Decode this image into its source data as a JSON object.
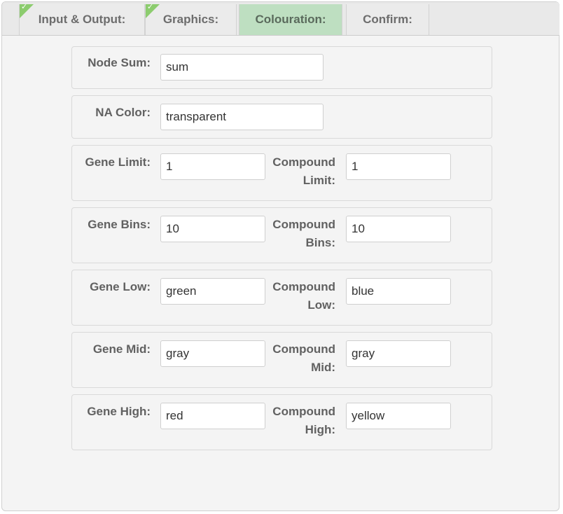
{
  "tabs": [
    {
      "label": "Input & Output:",
      "completed": true
    },
    {
      "label": "Graphics:",
      "completed": true
    },
    {
      "label": "Colouration:",
      "active": true
    },
    {
      "label": "Confirm:"
    }
  ],
  "form": {
    "node_sum": {
      "label": "Node Sum:",
      "value": "sum"
    },
    "na_color": {
      "label": "NA Color:",
      "value": "transparent"
    },
    "limit": {
      "gene_label": "Gene Limit:",
      "gene_value": "1",
      "compound_label_line1": "Compound",
      "compound_label_line2": "Limit:",
      "compound_value": "1"
    },
    "bins": {
      "gene_label": "Gene Bins:",
      "gene_value": "10",
      "compound_label_line1": "Compound",
      "compound_label_line2": "Bins:",
      "compound_value": "10"
    },
    "low": {
      "gene_label": "Gene Low:",
      "gene_value": "green",
      "compound_label_line1": "Compound",
      "compound_label_line2": "Low:",
      "compound_value": "blue"
    },
    "mid": {
      "gene_label": "Gene Mid:",
      "gene_value": "gray",
      "compound_label_line1": "Compound",
      "compound_label_line2": "Mid:",
      "compound_value": "gray"
    },
    "high": {
      "gene_label": "Gene High:",
      "gene_value": "red",
      "compound_label_line1": "Compound",
      "compound_label_line2": "High:",
      "compound_value": "yellow"
    }
  },
  "colors": {
    "active_tab": "#bedfc1",
    "check": "#8ccc6e",
    "panel": "#f4f4f4"
  }
}
